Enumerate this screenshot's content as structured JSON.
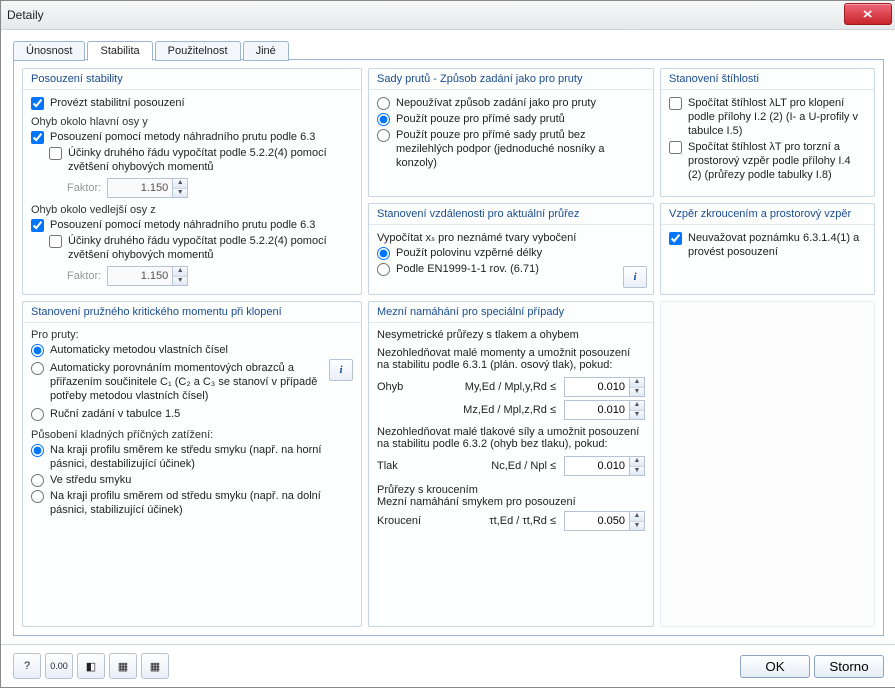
{
  "window": {
    "title": "Detaily"
  },
  "tabs": [
    "Únosnost",
    "Stabilita",
    "Použitelnost",
    "Jiné"
  ],
  "activeTab": 1,
  "col1": {
    "stability": {
      "title": "Posouzení stability",
      "run": "Provézt stabilitní posouzení",
      "axisY": "Ohyb okolo hlavní osy y",
      "method63_y": "Posouzení pomocí metody náhradního prutu podle 6.3",
      "secondOrder_y": "Účinky druhého řádu vypočítat podle 5.2.2(4) pomocí zvětšení ohybových momentů",
      "factorLabel": "Faktor:",
      "factor_y": "1.150",
      "axisZ": "Ohyb okolo vedlejší osy z",
      "method63_z": "Posouzení pomocí metody náhradního prutu podle 6.3",
      "secondOrder_z": "Účinky druhého řádu vypočítat podle 5.2.2(4) pomocí zvětšení ohybových momentů",
      "factor_z": "1.150"
    },
    "mcr": {
      "title": "Stanovení pružného kritického momentu při klopení",
      "forMembers": "Pro pruty:",
      "autoEigen": "Automaticky metodou vlastních čísel",
      "autoCompare": "Automaticky porovnáním momentových obrazců a přiřazením součinitele C₁ (C₂ a C₃ se stanoví v případě potřeby metodou vlastních čísel)",
      "manual15": "Ruční zadání v tabulce 1.5",
      "loadPos": "Působení kladných příčných zatížení:",
      "edgeToCenter": "Na kraji profilu směrem ke středu smyku (např. na horní pásnici, destabilizující účinek)",
      "atCenter": "Ve středu smyku",
      "edgeFromCenter": "Na kraji profilu směrem od středu smyku (např. na dolní pásnici, stabilizující účinek)"
    }
  },
  "col2": {
    "sets": {
      "title": "Sady prutů - Způsob zadání jako pro pruty",
      "none": "Nepoužívat způsob zadání jako pro pruty",
      "straight": "Použít pouze pro přímé sady prutů",
      "straightNoInter": "Použít pouze pro přímé sady prutů bez mezilehlých podpor (jednoduché nosníky a konzoly)"
    },
    "dist": {
      "title": "Stanovení vzdálenosti pro aktuální průřez",
      "descr": "Vypočítat xₛ pro neznámé tvary vybočení",
      "half": "Použít polovinu vzpěrné délky",
      "en1999": "Podle EN1999-1-1 rov. (6.71)"
    },
    "limit": {
      "title": "Mezní namáhání pro speciální případy",
      "asym": "Nesymetrické průřezy s tlakem a ohybem",
      "ignoreMom": "Nezohledňovat malé momenty a umožnit posouzení na stabilitu podle 6.3.1 (plán. osový tlak), pokud:",
      "ohyb": "Ohyb",
      "myEq": "My,Ed / Mpl,y,Rd  ≤",
      "mzEq": "Mz,Ed / Mpl,z,Rd  ≤",
      "val_my": "0.010",
      "val_mz": "0.010",
      "ignoreComp": "Nezohledňovat malé tlakové síly a umožnit posouzení na stabilitu podle 6.3.2 (ohyb bez tlaku), pokud:",
      "tlak": "Tlak",
      "ncEq": "Nc,Ed / Npl        ≤",
      "val_nc": "0.010",
      "torsionSec": "Průřezy s kroucením",
      "torsionDesc": "Mezní namáhání smykem pro posouzení",
      "kr": "Kroucení",
      "tauEq": "τt,Ed / τt,Rd       ≤",
      "val_tau": "0.050"
    }
  },
  "col3": {
    "slender": {
      "title": "Stanovení štíhlosti",
      "lt": "Spočítat štíhlost λLT pro klopení podle přílohy I.2 (2) (I- a U-profily v tabulce I.5)",
      "t": "Spočítat štíhlost λT pro torzní a prostorový vzpěr podle přílohy I.4 (2) (průřezy podle tabulky I.8)"
    },
    "torsBuck": {
      "title": "Vzpěr zkroucením a prostorový vzpěr",
      "note": "Neuvažovat poznámku 6.3.1.4(1) a provést posouzení"
    }
  },
  "footer": {
    "ok": "OK",
    "cancel": "Storno"
  }
}
